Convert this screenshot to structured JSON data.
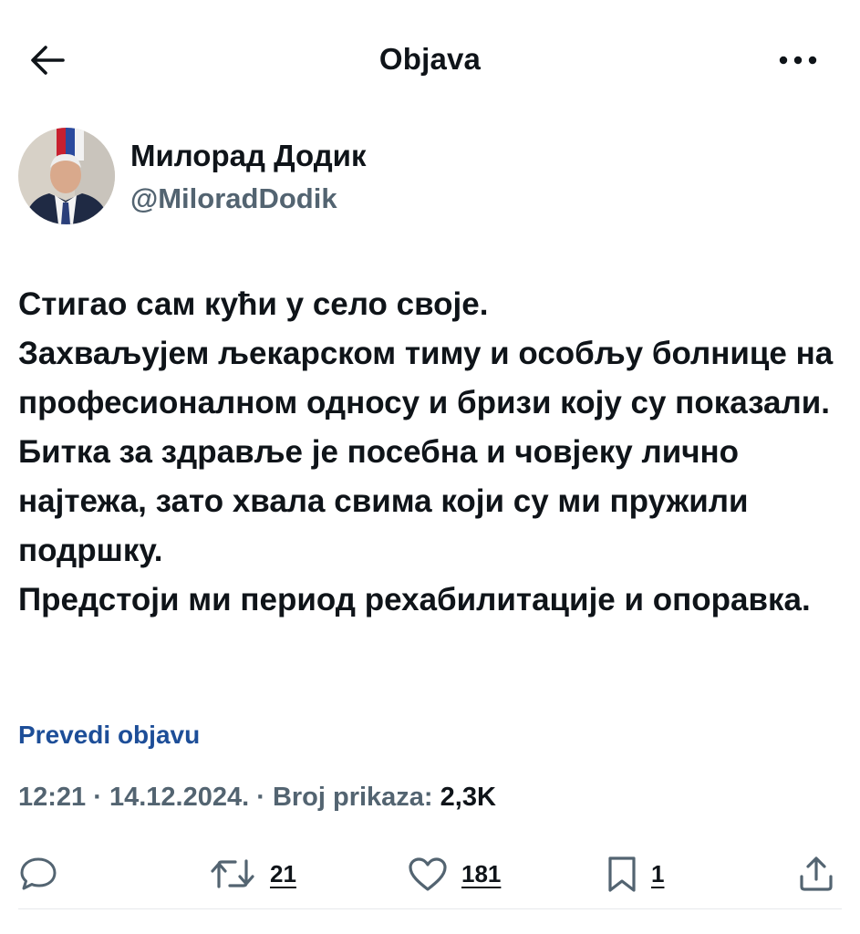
{
  "header": {
    "title": "Objava",
    "back_icon": "arrow-left-icon",
    "more_icon": "more-horizontal-icon"
  },
  "author": {
    "name": "Милорад Додик",
    "handle": "@MiloradDodik",
    "avatar_icon": "avatar-photo"
  },
  "post": {
    "text": "Стигао сам кући у село своје.\nЗахваљујем љекарском тиму и особљу болнице на професионалном односу и бризи коју су показали. Битка за здравље је посебна и човјеку лично најтежа, зато хвала свима који су ми пружили подршку.\nПредстоји ми период рехабилитације и опоравка.",
    "translate_label": "Prevedi objavu"
  },
  "meta": {
    "time": "12:21",
    "date": "14.12.2024.",
    "views_label": "Broj prikaza:",
    "views_count": "2,3K"
  },
  "actions": {
    "reply_icon": "reply-icon",
    "repost_icon": "repost-icon",
    "repost_count": "21",
    "like_icon": "heart-icon",
    "like_count": "181",
    "bookmark_icon": "bookmark-icon",
    "bookmark_count": "1",
    "share_icon": "share-icon"
  },
  "colors": {
    "text_primary": "#0f1419",
    "text_secondary": "#536471",
    "link": "#1d4e98",
    "icon": "#536471"
  }
}
